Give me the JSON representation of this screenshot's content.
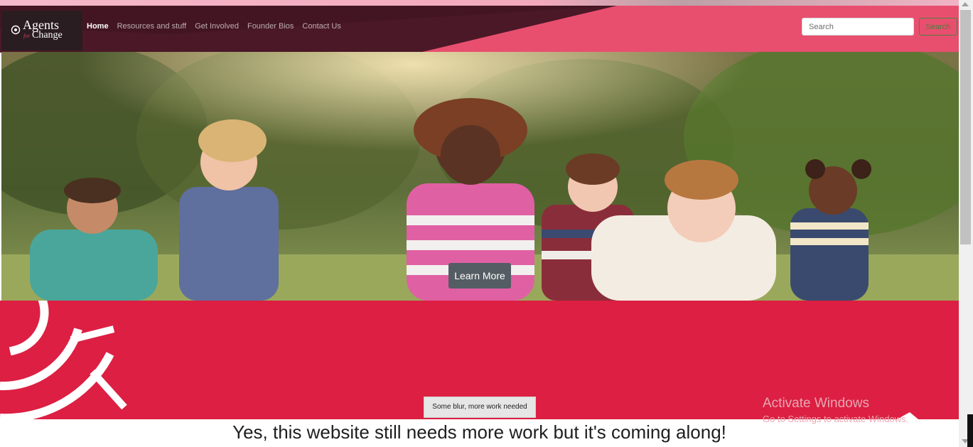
{
  "brand": {
    "name_line1": "Agents",
    "name_for": "for",
    "name_line2": "Change",
    "colors": {
      "primary": "#e84f6f",
      "dark": "#2a1d21",
      "band": "#dc1f42"
    }
  },
  "nav": {
    "items": [
      {
        "label": "Home",
        "active": true
      },
      {
        "label": "Resources and stuff",
        "active": false
      },
      {
        "label": "Get Involved",
        "active": false
      },
      {
        "label": "Founder Bios",
        "active": false
      },
      {
        "label": "Contact Us",
        "active": false
      }
    ]
  },
  "search": {
    "placeholder": "Search",
    "button_label": "Search"
  },
  "hero": {
    "cta_label": "Learn More",
    "image_desc_icon": "children-running-photo"
  },
  "band": {
    "note": "Some blur, more work needed"
  },
  "headline": "Yes, this website still needs more work but it's coming along!",
  "watermark": {
    "title": "Activate Windows",
    "subtitle": "Go to Settings to activate Windows."
  }
}
